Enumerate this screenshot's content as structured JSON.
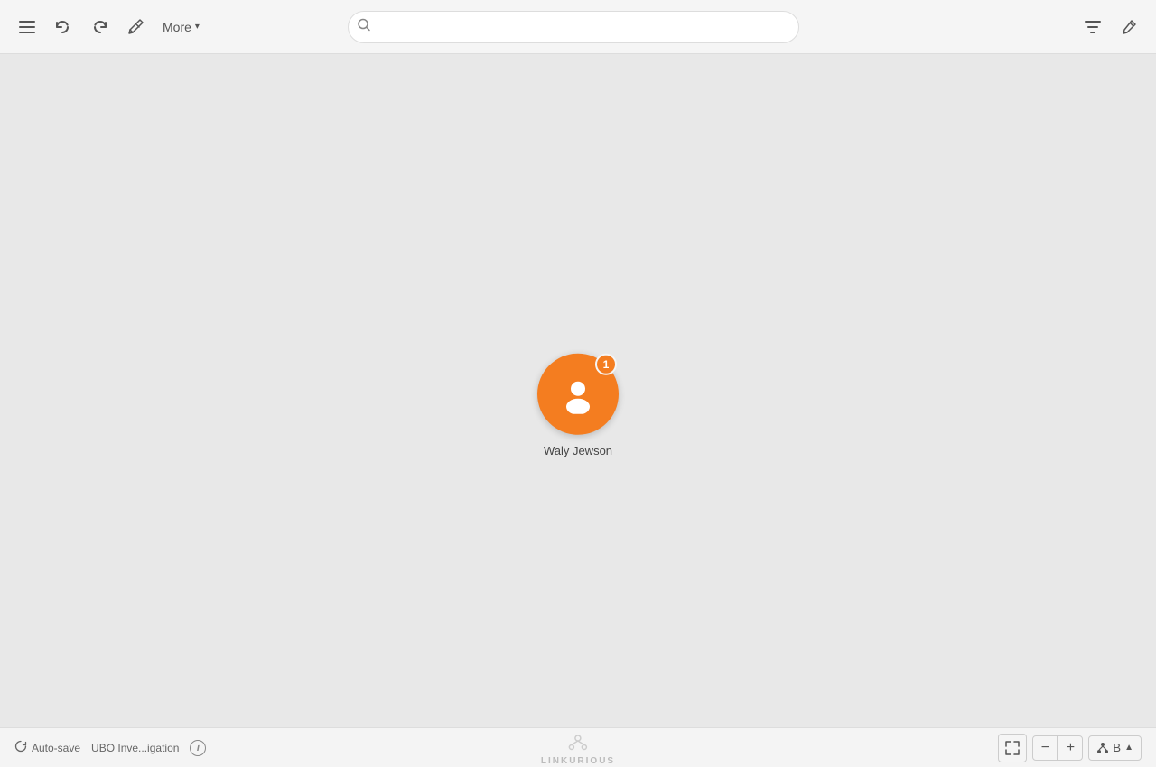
{
  "toolbar": {
    "more_label": "More",
    "search_placeholder": "",
    "undo_icon": "undo-icon",
    "redo_icon": "redo-icon",
    "pin_icon": "pin-icon",
    "filter_icon": "filter-icon",
    "edit_icon": "edit-icon"
  },
  "node": {
    "label": "Waly Jewson",
    "badge_count": "1",
    "color": "#f47d20"
  },
  "bottom_bar": {
    "autosave_label": "Auto-save",
    "investigation_name": "UBO Inve...igation",
    "logo_text": "LINKURIOUS",
    "zoom_minus": "−",
    "zoom_plus": "+",
    "layout_label": "B",
    "fullscreen_icon": "fullscreen-icon"
  }
}
